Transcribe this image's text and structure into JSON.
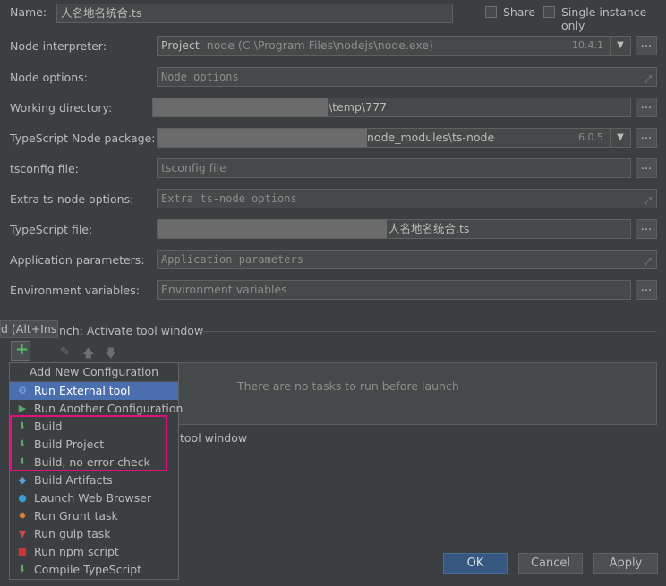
{
  "header": {
    "name_label": "Name:",
    "name_value": "人名地名统合.ts",
    "share_label": "Share",
    "single_instance_label": "Single instance only"
  },
  "form": {
    "node_interpreter": {
      "label": "Node interpreter:",
      "prefix": "Project",
      "value": "node (C:\\Program Files\\nodejs\\node.exe)",
      "version": "10.4.1",
      "browse": "..."
    },
    "node_options": {
      "label": "Node options:",
      "placeholder": "Node options"
    },
    "working_directory": {
      "label": "Working directory:",
      "value_suffix": "\\temp\\777",
      "browse": "..."
    },
    "ts_node_package": {
      "label": "TypeScript Node package:",
      "value_suffix": "node_modules\\ts-node",
      "version": "6.0.5",
      "browse": "..."
    },
    "tsconfig_file": {
      "label": "tsconfig file:",
      "placeholder": "tsconfig file",
      "browse": "..."
    },
    "extra_ts_node_options": {
      "label": "Extra ts-node options:",
      "placeholder": "Extra ts-node options"
    },
    "typescript_file": {
      "label": "TypeScript file:",
      "value_suffix": "人名地名统合.ts",
      "browse": "..."
    },
    "application_parameters": {
      "label": "Application parameters:",
      "placeholder": "Application parameters"
    },
    "environment_variables": {
      "label": "Environment variables:",
      "placeholder": "Environment variables",
      "browse": "..."
    }
  },
  "before_launch": {
    "tooltip": "d (Alt+Insert)",
    "section_label_tail": "nch: Activate tool window",
    "empty_text": "There are no tasks to run before launch",
    "show_page_tail": "tool window"
  },
  "popup_menu": {
    "title": "Add New Configuration",
    "items": [
      {
        "label": "Run External tool",
        "icon": "gear-icon",
        "selected": true
      },
      {
        "label": "Run Another Configuration",
        "icon": "play-icon"
      },
      {
        "label": "Build",
        "icon": "build-icon"
      },
      {
        "label": "Build Project",
        "icon": "build-icon"
      },
      {
        "label": "Build, no error check",
        "icon": "build-icon"
      },
      {
        "label": "Build Artifacts",
        "icon": "artifact-icon"
      },
      {
        "label": "Launch Web Browser",
        "icon": "globe-icon"
      },
      {
        "label": "Run Grunt task",
        "icon": "grunt-icon"
      },
      {
        "label": "Run gulp task",
        "icon": "gulp-icon"
      },
      {
        "label": "Run npm script",
        "icon": "npm-icon"
      },
      {
        "label": "Compile TypeScript",
        "icon": "compile-icon"
      }
    ]
  },
  "buttons": {
    "ok": "OK",
    "cancel": "Cancel",
    "apply": "Apply"
  },
  "colors": {
    "background": "#3c3f41",
    "field_bg": "#45494a",
    "selection": "#4b6eaf",
    "highlight_box": "#e0107e",
    "ok_button": "#365880"
  }
}
